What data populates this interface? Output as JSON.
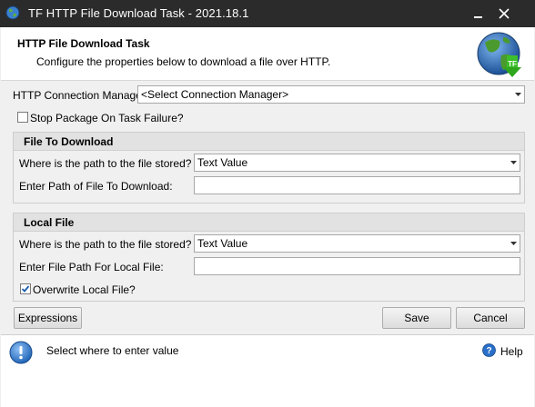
{
  "window": {
    "title": "TF HTTP File Download Task - 2021.18.1",
    "minimize_glyph": "_",
    "close_glyph": "✕"
  },
  "header": {
    "heading": "HTTP File Download Task",
    "description": "Configure the properties below to download a file over HTTP.",
    "logo_icon": "globe-download-icon",
    "logo_badge": "TF"
  },
  "connection": {
    "label": "HTTP Connection Manager:",
    "value": "<Select Connection Manager>"
  },
  "stop_package": {
    "label": "Stop Package On Task Failure?",
    "checked": false
  },
  "file_to_download": {
    "group_title": "File To Download",
    "path_source_label": "Where is the path to the file stored?",
    "path_source_value": "Text Value",
    "path_label": "Enter Path of File To Download:",
    "path_value": ""
  },
  "local_file": {
    "group_title": "Local File",
    "path_source_label": "Where is the path to the file stored?",
    "path_source_value": "Text Value",
    "path_label": "Enter File Path For Local File:",
    "path_value": "",
    "overwrite_label": "Overwrite Local File?",
    "overwrite_checked": true
  },
  "buttons": {
    "expressions": "Expressions",
    "save": "Save",
    "cancel": "Cancel"
  },
  "status": {
    "message": "Select where to enter value",
    "help_label": "Help"
  },
  "colors": {
    "titlebar": "#2b2b2b",
    "accent_blue": "#1a5fb4",
    "check": "#1c5fb0"
  }
}
